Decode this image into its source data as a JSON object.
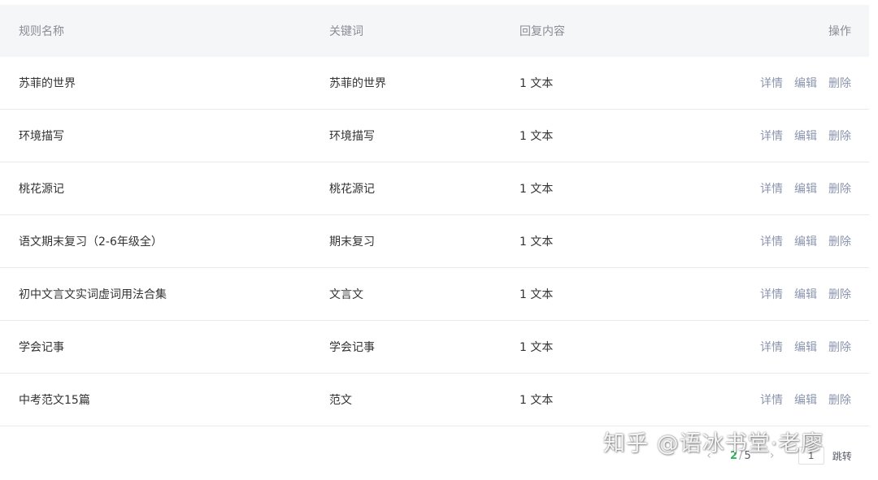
{
  "table": {
    "headers": {
      "name": "规则名称",
      "keyword": "关键词",
      "reply": "回复内容",
      "ops": "操作"
    },
    "rows": [
      {
        "name": "苏菲的世界",
        "keyword": "苏菲的世界",
        "reply": "1 文本"
      },
      {
        "name": "环境描写",
        "keyword": "环境描写",
        "reply": "1 文本"
      },
      {
        "name": "桃花源记",
        "keyword": "桃花源记",
        "reply": "1 文本"
      },
      {
        "name": "语文期末复习（2-6年级全）",
        "keyword": "期末复习",
        "reply": "1 文本"
      },
      {
        "name": "初中文言文实词虚词用法合集",
        "keyword": "文言文",
        "reply": "1 文本"
      },
      {
        "name": "学会记事",
        "keyword": "学会记事",
        "reply": "1 文本"
      },
      {
        "name": "中考范文15篇",
        "keyword": "范文",
        "reply": "1 文本"
      }
    ],
    "actions": {
      "detail": "详情",
      "edit": "编辑",
      "delete": "删除"
    }
  },
  "pagination": {
    "prev": "‹",
    "current": "2",
    "separator": "/",
    "total": "5",
    "next": "›",
    "jump_value": "1",
    "jump_label": "跳转"
  },
  "watermark": {
    "text": "知乎 @语冰书堂·老廖"
  },
  "colors": {
    "header_bg": "#f5f6f8",
    "link": "#8a94ad",
    "accent": "#2bb35c"
  }
}
